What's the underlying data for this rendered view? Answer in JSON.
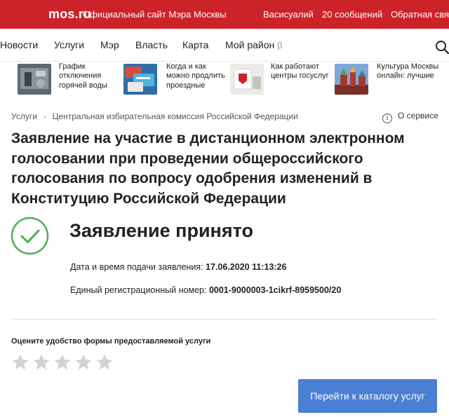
{
  "header": {
    "logo": "mos.ru",
    "official_site": "Официальный сайт Мэра Москвы",
    "user": "Васисуалий",
    "messages": "20 сообщений",
    "feedback": "Обратная связь",
    "brand_color": "#cc2229"
  },
  "nav": {
    "items": [
      "Новости",
      "Услуги",
      "Мэр",
      "Власть",
      "Карта",
      "Мой район"
    ],
    "beta": "β"
  },
  "news": [
    {
      "text": "График отключения горячей воды"
    },
    {
      "text": "Когда и как можно продлить проездные"
    },
    {
      "text": "Как работают центры госуслуг"
    },
    {
      "text": "Культура Москвы онлайн: лучшие"
    }
  ],
  "breadcrumb": {
    "root": "Услуги",
    "current": "Центральная избирательная комиссия Российской Федерации"
  },
  "about_service": "О сервисе",
  "title": "Заявление на участие в дистанционном электронном голосовании при проведении общероссийского голосования по вопросу одобрения изменений в Конституцию Российской Федерации",
  "status": {
    "heading": "Заявление принято",
    "date_label": "Дата и время подачи заявления:",
    "date_value": "17.06.2020 11:13:26",
    "reg_label": "Единый регистрационный номер:",
    "reg_value": "0001-9000003-1cikrf-8959500/20",
    "check_color": "#4caf50"
  },
  "rating": {
    "label": "Оцените удобство формы предоставляемой услуги",
    "max_stars": 5,
    "value": 0
  },
  "catalog_button": "Перейти к каталогу услуг",
  "button_color": "#4a7fd4"
}
